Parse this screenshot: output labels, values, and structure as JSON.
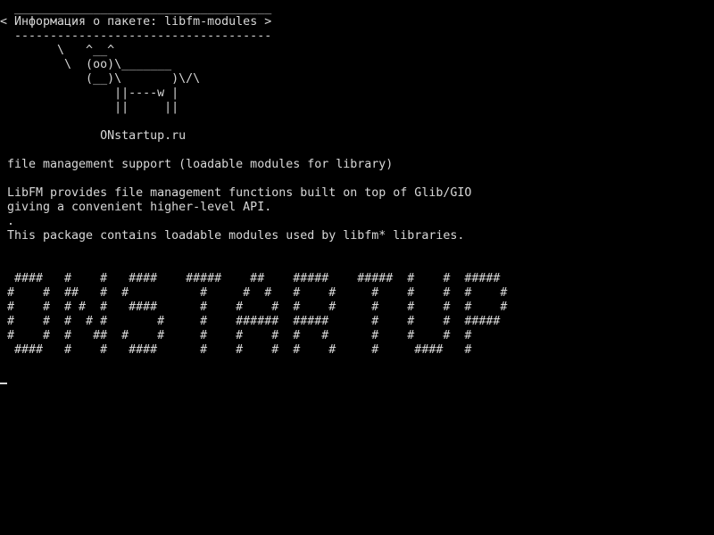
{
  "terminal": {
    "background": "#000000",
    "foreground": "#d8d8d8",
    "cowsay": {
      "bubble_top": " ____________________________________",
      "bubble_text": "< Информация о пакете: libfm-modules >",
      "bubble_bottom": " ------------------------------------",
      "cow": [
        "       \\   ^__^",
        "        \\  (oo)\\_______",
        "           (__)\\       )\\/\\",
        "               ||----w |",
        "               ||     ||"
      ],
      "site": "             ONstartup.ru"
    },
    "package": {
      "summary": "file management support (loadable modules for library)",
      "description": [
        "LibFM provides file management functions built on top of Glib/GIO",
        "giving a convenient higher-level API.",
        ".",
        "This package contains loadable modules used by libfm* libraries."
      ]
    },
    "banner": [
      " ####   #    #   ####    #####    ##    #####    #####  #    #  #####",
      "#    #  ##   #  #          #     #  #   #    #     #    #    #  #    #",
      "#    #  # #  #   ####      #    #    #  #    #     #    #    #  #    #",
      "#    #  #  # #       #     #    ######  #####      #    #    #  #####",
      "#    #  #   ##  #    #     #    #    #  #   #      #    #    #  #",
      " ####   #    #   ####      #    #    #  #    #     #     ####   #"
    ]
  }
}
